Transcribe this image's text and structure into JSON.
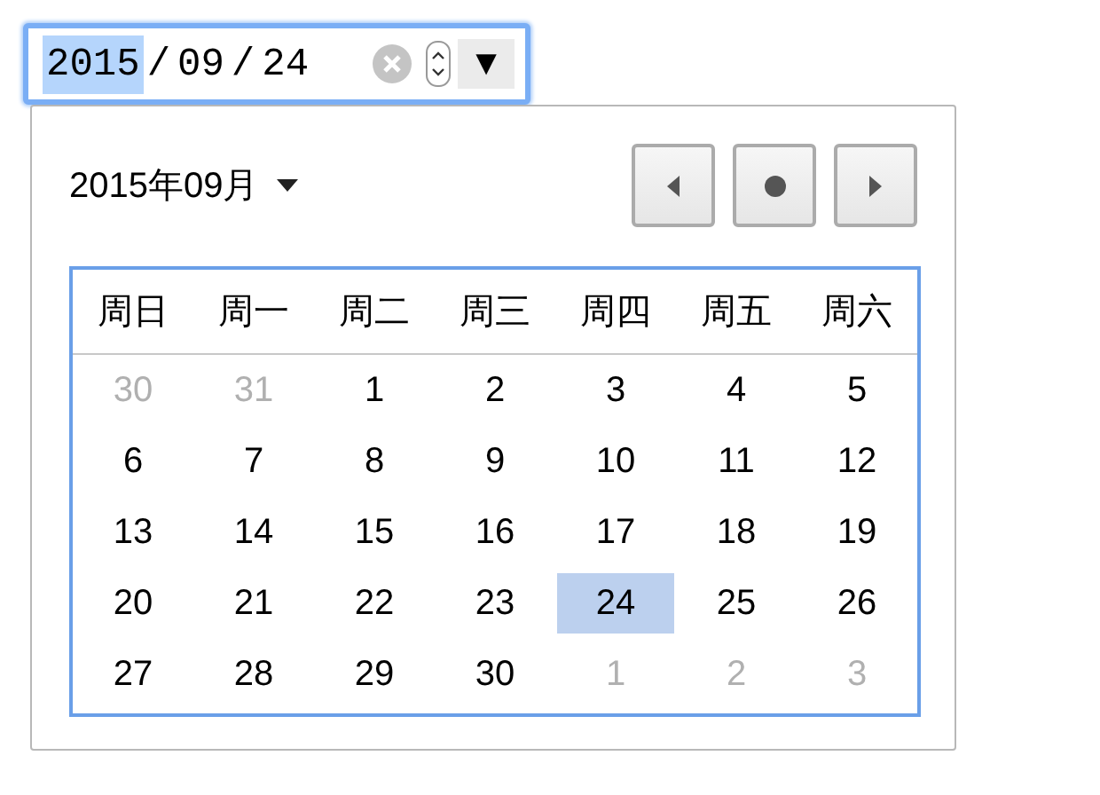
{
  "date_input": {
    "segments": [
      {
        "text": "2015",
        "selected": true
      },
      {
        "text": "/",
        "selected": false
      },
      {
        "text": "09",
        "selected": false
      },
      {
        "text": "/",
        "selected": false
      },
      {
        "text": "24",
        "selected": false
      }
    ],
    "dropdown_glyph": "▼"
  },
  "calendar": {
    "month_label": "2015年09月",
    "weekdays": [
      "周日",
      "周一",
      "周二",
      "周三",
      "周四",
      "周五",
      "周六"
    ],
    "weeks": [
      [
        {
          "day": "30",
          "other_month": true,
          "selected": false
        },
        {
          "day": "31",
          "other_month": true,
          "selected": false
        },
        {
          "day": "1",
          "other_month": false,
          "selected": false
        },
        {
          "day": "2",
          "other_month": false,
          "selected": false
        },
        {
          "day": "3",
          "other_month": false,
          "selected": false
        },
        {
          "day": "4",
          "other_month": false,
          "selected": false
        },
        {
          "day": "5",
          "other_month": false,
          "selected": false
        }
      ],
      [
        {
          "day": "6",
          "other_month": false,
          "selected": false
        },
        {
          "day": "7",
          "other_month": false,
          "selected": false
        },
        {
          "day": "8",
          "other_month": false,
          "selected": false
        },
        {
          "day": "9",
          "other_month": false,
          "selected": false
        },
        {
          "day": "10",
          "other_month": false,
          "selected": false
        },
        {
          "day": "11",
          "other_month": false,
          "selected": false
        },
        {
          "day": "12",
          "other_month": false,
          "selected": false
        }
      ],
      [
        {
          "day": "13",
          "other_month": false,
          "selected": false
        },
        {
          "day": "14",
          "other_month": false,
          "selected": false
        },
        {
          "day": "15",
          "other_month": false,
          "selected": false
        },
        {
          "day": "16",
          "other_month": false,
          "selected": false
        },
        {
          "day": "17",
          "other_month": false,
          "selected": false
        },
        {
          "day": "18",
          "other_month": false,
          "selected": false
        },
        {
          "day": "19",
          "other_month": false,
          "selected": false
        }
      ],
      [
        {
          "day": "20",
          "other_month": false,
          "selected": false
        },
        {
          "day": "21",
          "other_month": false,
          "selected": false
        },
        {
          "day": "22",
          "other_month": false,
          "selected": false
        },
        {
          "day": "23",
          "other_month": false,
          "selected": false
        },
        {
          "day": "24",
          "other_month": false,
          "selected": true
        },
        {
          "day": "25",
          "other_month": false,
          "selected": false
        },
        {
          "day": "26",
          "other_month": false,
          "selected": false
        }
      ],
      [
        {
          "day": "27",
          "other_month": false,
          "selected": false
        },
        {
          "day": "28",
          "other_month": false,
          "selected": false
        },
        {
          "day": "29",
          "other_month": false,
          "selected": false
        },
        {
          "day": "30",
          "other_month": false,
          "selected": false
        },
        {
          "day": "1",
          "other_month": true,
          "selected": false
        },
        {
          "day": "2",
          "other_month": true,
          "selected": false
        },
        {
          "day": "3",
          "other_month": true,
          "selected": false
        }
      ]
    ]
  }
}
